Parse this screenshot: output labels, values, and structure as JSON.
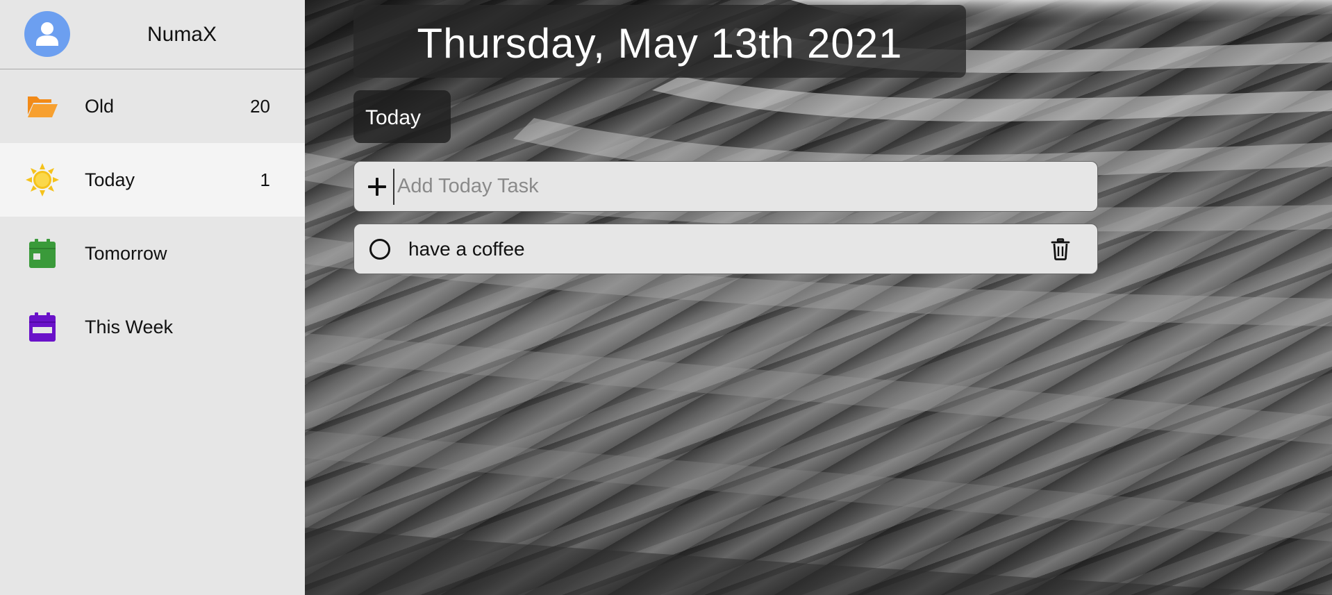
{
  "profile": {
    "username": "NumaX",
    "avatar_icon": "user-avatar-icon",
    "avatar_color": "#6c9ff0"
  },
  "sidebar": {
    "items": [
      {
        "label": "Old",
        "count": "20",
        "icon": "folder-open-icon",
        "color": "#f28a18",
        "active": false
      },
      {
        "label": "Today",
        "count": "1",
        "icon": "sun-icon",
        "color": "#f5c21b",
        "active": true
      },
      {
        "label": "Tomorrow",
        "count": "",
        "icon": "calendar-icon",
        "color": "#3a9a3a",
        "active": false
      },
      {
        "label": "This Week",
        "count": "",
        "icon": "calendar-week-icon",
        "color": "#6a12c9",
        "active": false
      }
    ]
  },
  "main": {
    "date": "Thursday, May 13th 2021",
    "list_title": "Today",
    "add_task": {
      "placeholder": "Add Today Task",
      "value": ""
    },
    "tasks": [
      {
        "text": "have a coffee",
        "done": false
      }
    ]
  }
}
